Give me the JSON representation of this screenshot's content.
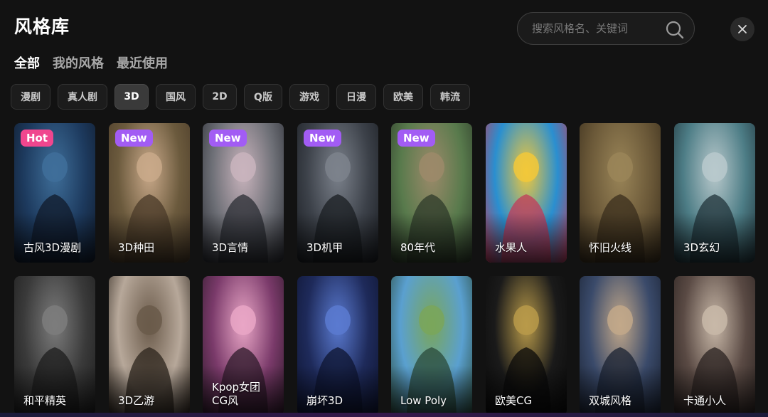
{
  "header": {
    "title": "风格库"
  },
  "search": {
    "placeholder": "搜索风格名、关键词",
    "icon": "search-icon"
  },
  "close": {
    "icon": "close-icon"
  },
  "tabs": [
    {
      "label": "全部",
      "active": true
    },
    {
      "label": "我的风格",
      "active": false
    },
    {
      "label": "最近使用",
      "active": false
    }
  ],
  "filters": [
    {
      "label": "漫剧",
      "active": false
    },
    {
      "label": "真人剧",
      "active": false
    },
    {
      "label": "3D",
      "active": true
    },
    {
      "label": "国风",
      "active": false
    },
    {
      "label": "2D",
      "active": false
    },
    {
      "label": "Q版",
      "active": false
    },
    {
      "label": "游戏",
      "active": false
    },
    {
      "label": "日漫",
      "active": false
    },
    {
      "label": "欧美",
      "active": false
    },
    {
      "label": "韩流",
      "active": false
    }
  ],
  "cards": [
    {
      "label": "古风3D漫剧",
      "badge": "Hot",
      "colors": [
        "#1d3a5e",
        "#3f6f9a",
        "#101a2a"
      ]
    },
    {
      "label": "3D种田",
      "badge": "New",
      "colors": [
        "#6b5a3d",
        "#c9a98a",
        "#4a3a28"
      ]
    },
    {
      "label": "3D言情",
      "badge": "New",
      "colors": [
        "#6d6f76",
        "#c9b4bd",
        "#2a2c33"
      ]
    },
    {
      "label": "3D机甲",
      "badge": "New",
      "colors": [
        "#3c4149",
        "#7c828c",
        "#1a1d22"
      ]
    },
    {
      "label": "80年代",
      "badge": "New",
      "colors": [
        "#587a4c",
        "#9c8a6a",
        "#2d3a2a"
      ]
    },
    {
      "label": "水果人",
      "badge": "",
      "colors": [
        "#2a8fd0",
        "#f2c83a",
        "#c23a5a"
      ]
    },
    {
      "label": "怀旧火线",
      "badge": "",
      "colors": [
        "#6a5838",
        "#9a8558",
        "#3a2e1c"
      ]
    },
    {
      "label": "3D玄幻",
      "badge": "",
      "colors": [
        "#4d7d86",
        "#b9c9cc",
        "#20333a"
      ]
    },
    {
      "label": "和平精英",
      "badge": "",
      "colors": [
        "#3a3a3a",
        "#7c7c7c",
        "#1c1c1c"
      ]
    },
    {
      "label": "3D乙游",
      "badge": "",
      "colors": [
        "#b7a89a",
        "#6a5a4a",
        "#2c241c"
      ]
    },
    {
      "label": "Kpop女团\nCG风",
      "badge": "",
      "colors": [
        "#7a3a6a",
        "#e9a6c6",
        "#2e1a2a"
      ]
    },
    {
      "label": "崩坏3D",
      "badge": "",
      "colors": [
        "#1e2a5a",
        "#5a7ad0",
        "#0e1430"
      ]
    },
    {
      "label": "Low Poly",
      "badge": "",
      "colors": [
        "#5aa0d0",
        "#7aa65a",
        "#2a4a3a"
      ]
    },
    {
      "label": "欧美CG",
      "badge": "",
      "colors": [
        "#1a1a1a",
        "#b89a4a",
        "#0a0a0a"
      ]
    },
    {
      "label": "双城风格",
      "badge": "",
      "colors": [
        "#3a4a6a",
        "#c2a88a",
        "#1a2232"
      ]
    },
    {
      "label": "卡通小人",
      "badge": "",
      "colors": [
        "#5a4a44",
        "#c8b8a8",
        "#2a2220"
      ]
    }
  ]
}
